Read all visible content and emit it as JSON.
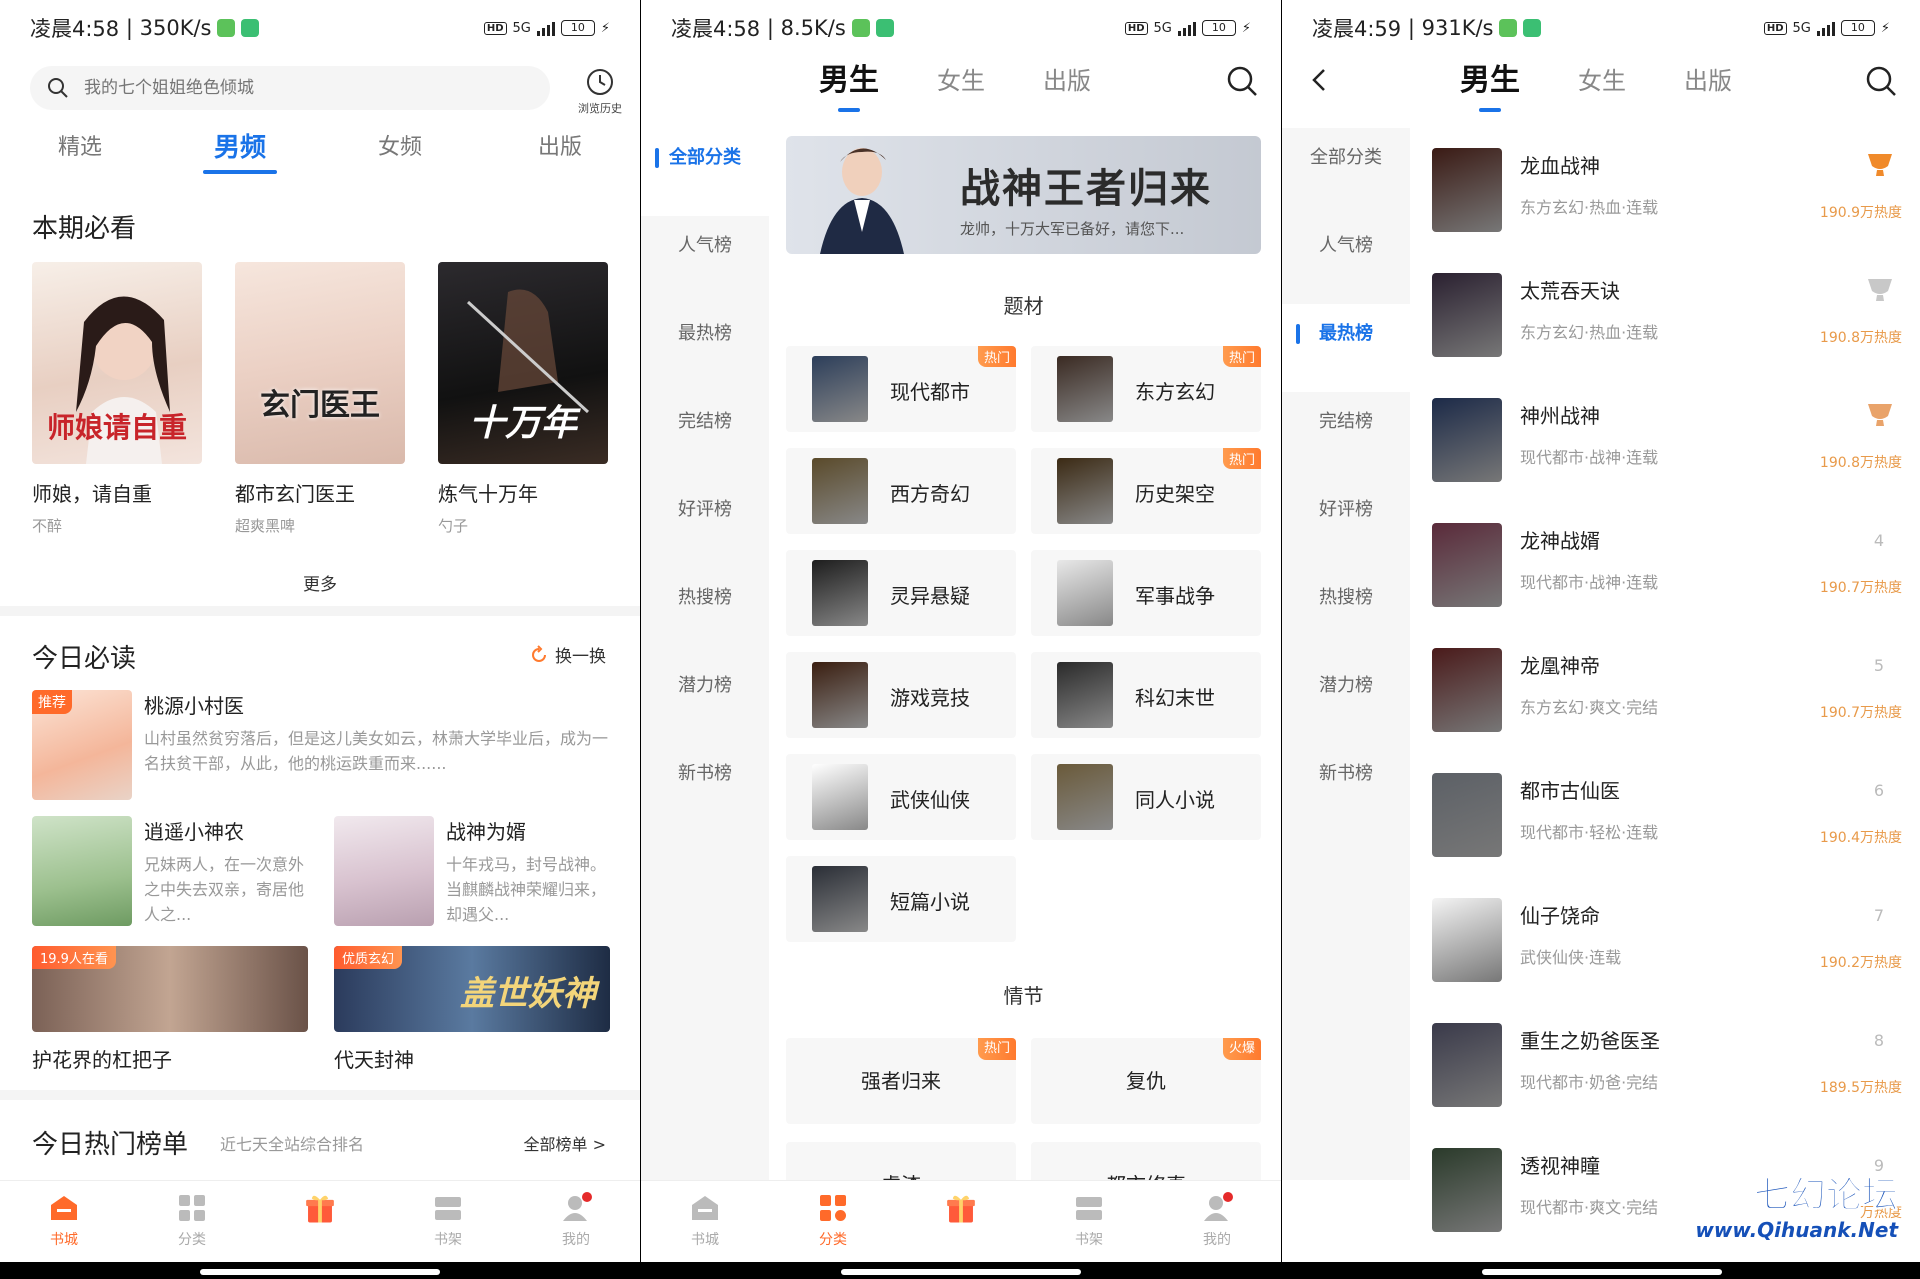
{
  "status_bars": [
    {
      "time": "凌晨4:58",
      "speed": "350K/s",
      "battery": "10"
    },
    {
      "time": "凌晨4:58",
      "speed": "8.5K/s",
      "battery": "10"
    },
    {
      "time": "凌晨4:59",
      "speed": "931K/s",
      "battery": "10"
    }
  ],
  "status_common": {
    "hd": "HD",
    "net": "5G",
    "sep": " | "
  },
  "panel1": {
    "search_placeholder": "我的七个姐姐绝色倾城",
    "history_label": "浏览历史",
    "tabs": [
      "精选",
      "男频",
      "女频",
      "出版"
    ],
    "active_tab": 1,
    "must_see_title": "本期必看",
    "must_see_books": [
      {
        "title": "师娘，请自重",
        "author": "不醉",
        "cover_text": "师娘请自重"
      },
      {
        "title": "都市玄门医王",
        "author": "超爽黑啤",
        "cover_text": "玄门医王"
      },
      {
        "title": "炼气十万年",
        "author": "勺子",
        "cover_text": "十万年"
      }
    ],
    "more_label": "更多",
    "today_title": "今日必读",
    "swap_label": "换一换",
    "recommend": {
      "badge": "推荐",
      "title": "桃源小村医",
      "desc": "山村虽然贫穷落后，但是这儿美女如云，林萧大学毕业后，成为一名扶贫干部，从此，他的桃运跌重而来......"
    },
    "pair_books": [
      {
        "title": "逍遥小神农",
        "desc": "兄妹两人，在一次意外之中失去双亲，寄居他人之..."
      },
      {
        "title": "战神为婿",
        "desc": "十年戎马，封号战神。当麒麟战神荣耀归来，却遇父..."
      }
    ],
    "wide_books": [
      {
        "tag": "19.9人在看",
        "title": "护花界的杠把子"
      },
      {
        "tag": "优质玄幻",
        "title": "代天封神",
        "cover_text": "盖世妖神"
      }
    ],
    "hot_title": "今日热门榜单",
    "hot_sub": "近七天全站综合排名",
    "hot_all": "全部榜单 >"
  },
  "gender_tabs": [
    "男生",
    "女生",
    "出版"
  ],
  "panel2": {
    "side": [
      "全部分类",
      "人气榜",
      "最热榜",
      "完结榜",
      "好评榜",
      "热搜榜",
      "潜力榜",
      "新书榜"
    ],
    "banner_title": "战神王者归来",
    "banner_sub": "龙帅，十万大军已备好，请您下...",
    "genre_title": "题材",
    "genres": [
      {
        "label": "现代都市",
        "badge": "热门"
      },
      {
        "label": "东方玄幻",
        "badge": "热门"
      },
      {
        "label": "西方奇幻",
        "badge": ""
      },
      {
        "label": "历史架空",
        "badge": "热门"
      },
      {
        "label": "灵异悬疑",
        "badge": ""
      },
      {
        "label": "军事战争",
        "badge": ""
      },
      {
        "label": "游戏竞技",
        "badge": ""
      },
      {
        "label": "科幻末世",
        "badge": ""
      },
      {
        "label": "武侠仙侠",
        "badge": ""
      },
      {
        "label": "同人小说",
        "badge": ""
      },
      {
        "label": "短篇小说",
        "badge": ""
      }
    ],
    "plot_title": "情节",
    "plots": [
      {
        "label": "强者归来",
        "badge": "热门"
      },
      {
        "label": "复仇",
        "badge": "火爆"
      },
      {
        "label": "虐渣",
        "badge": ""
      },
      {
        "label": "都市修真",
        "badge": ""
      }
    ]
  },
  "panel3": {
    "side": [
      "全部分类",
      "人气榜",
      "最热榜",
      "完结榜",
      "好评榜",
      "热搜榜",
      "潜力榜",
      "新书榜"
    ],
    "ranks": [
      {
        "no": "",
        "title": "龙血战神",
        "meta": "东方玄幻·热血·连载",
        "heat": "190.9万热度"
      },
      {
        "no": "",
        "title": "太荒吞天诀",
        "meta": "东方玄幻·热血·连载",
        "heat": "190.8万热度"
      },
      {
        "no": "",
        "title": "神州战神",
        "meta": "现代都市·战神·连载",
        "heat": "190.8万热度"
      },
      {
        "no": "4",
        "title": "龙神战婿",
        "meta": "现代都市·战神·连载",
        "heat": "190.7万热度"
      },
      {
        "no": "5",
        "title": "龙凰神帝",
        "meta": "东方玄幻·爽文·完结",
        "heat": "190.7万热度"
      },
      {
        "no": "6",
        "title": "都市古仙医",
        "meta": "现代都市·轻松·连载",
        "heat": "190.4万热度"
      },
      {
        "no": "7",
        "title": "仙子饶命",
        "meta": "武侠仙侠·连载",
        "heat": "190.2万热度"
      },
      {
        "no": "8",
        "title": "重生之奶爸医圣",
        "meta": "现代都市·奶爸·完结",
        "heat": "189.5万热度"
      },
      {
        "no": "9",
        "title": "透视神瞳",
        "meta": "现代都市·爽文·完结",
        "heat": "万热度"
      }
    ]
  },
  "nav": [
    "书城",
    "分类",
    "",
    "书架",
    "我的"
  ],
  "watermark": {
    "cn": "七幻论坛",
    "en": "www.Qihuank.Net"
  },
  "colors": {
    "accent": "#1a73e8",
    "orange": "#ff6a2a"
  }
}
